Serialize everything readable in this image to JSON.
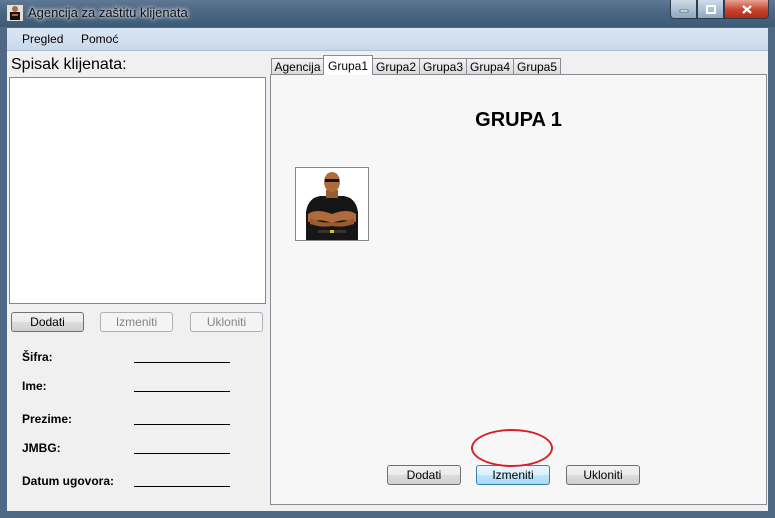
{
  "window": {
    "title": "Agencija za zaštitu klijenata",
    "icon": "bodyguard-app-icon",
    "controls": [
      "minimize-icon",
      "maximize-icon",
      "close-icon"
    ]
  },
  "menu": {
    "items": [
      "Pregled",
      "Pomoć"
    ]
  },
  "left_panel": {
    "title": "Spisak klijenata:",
    "buttons": {
      "add": "Dodati",
      "edit": "Izmeniti",
      "remove": "Ukloniti"
    },
    "fields": [
      {
        "label": "Šifra:",
        "value": ""
      },
      {
        "label": "Ime:",
        "value": ""
      },
      {
        "label": "Prezime:",
        "value": ""
      },
      {
        "label": "JMBG:",
        "value": ""
      },
      {
        "label": "Datum ugovora:",
        "value": ""
      }
    ]
  },
  "tabs": {
    "items": [
      "Agencija",
      "Grupa1",
      "Grupa2",
      "Grupa3",
      "Grupa4",
      "Grupa5"
    ],
    "selected": "Grupa1"
  },
  "group_panel": {
    "title": "GRUPA 1",
    "member_image": "bodyguard-avatar-icon",
    "buttons": {
      "add": "Dodati",
      "edit": "Izmeniti",
      "remove": "Ukloniti"
    },
    "annotation_color": "#d8202a"
  },
  "colors": {
    "menubar": "#c8d8ea",
    "focused_button": "#bee6fd",
    "titlebar": "#4a6682"
  }
}
